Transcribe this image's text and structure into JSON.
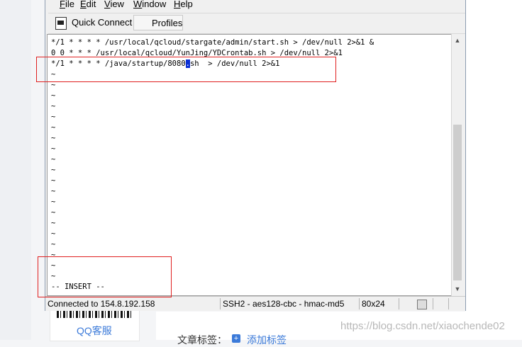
{
  "menu": {
    "items": [
      {
        "label": "File",
        "u": "F",
        "rest": "ile"
      },
      {
        "label": "Edit",
        "u": "E",
        "rest": "dit"
      },
      {
        "label": "View",
        "u": "V",
        "rest": "iew"
      },
      {
        "label": "Window",
        "u": "W",
        "rest": "indow"
      },
      {
        "label": "Help",
        "u": "H",
        "rest": "elp"
      }
    ]
  },
  "toolbar": {
    "quick_connect": "Quick Connect",
    "profiles": "Profiles"
  },
  "terminal": {
    "line1": "*/1 * * * * /usr/local/qcloud/stargate/admin/start.sh > /dev/null 2>&1 &",
    "line2": "0 0 * * * /usr/local/qcloud/YunJing/YDCrontab.sh > /dev/null 2>&1",
    "line3_before": "*/1 * * * * /java/startup/8080",
    "line3_cursor": ".",
    "line3_after": "sh  > /dev/null 2>&1",
    "tilde": "~",
    "mode": "-- INSERT --"
  },
  "status": {
    "connection": "Connected to 154.8.192.158",
    "cipher": "SSH2 - aes128-cbc - hmac-md5",
    "size": "80x24"
  },
  "background": {
    "qq_service": "QQ客服",
    "tags_label": "文章标签：",
    "add_tag": "添加标签",
    "watermark": "https://blog.csdn.net/xiaochende02"
  },
  "colors": {
    "highlight_box": "#e02020",
    "cursor": "#0a2fd6"
  }
}
